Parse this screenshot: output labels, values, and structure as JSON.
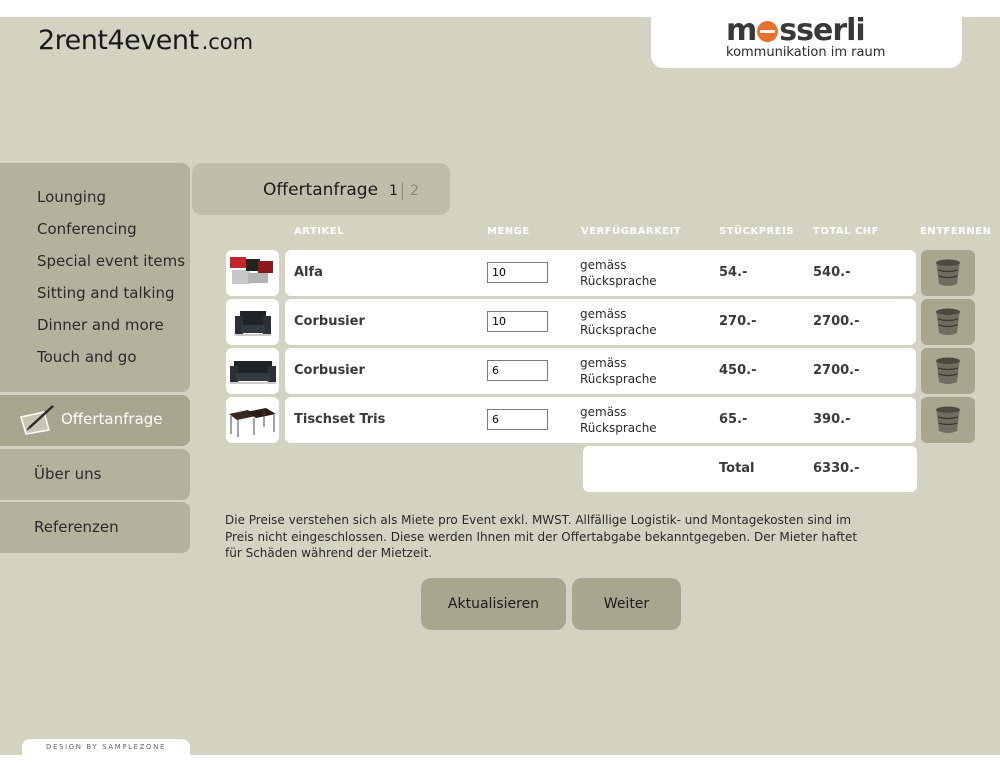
{
  "header": {
    "brand_main": "2rent4event",
    "brand_tld": ".com",
    "logo_prefix": "m",
    "logo_suffix": "sserli",
    "logo_tagline": "kommunikation im raum"
  },
  "nav": {
    "items": [
      "Lounging",
      "Conferencing",
      "Special event items",
      "Sitting and talking",
      "Dinner and more",
      "Touch and go"
    ],
    "offer": "Offertanfrage",
    "about": "Über uns",
    "references": "Referenzen"
  },
  "page": {
    "title": "Offertanfrage",
    "step_current": "1",
    "step_next": "2"
  },
  "table": {
    "headers": {
      "article": "ARTIKEL",
      "quantity": "MENGE",
      "availability": "VERFÜGBARKEIT",
      "unit_price": "STÜCKPREIS",
      "total": "TOTAL CHF",
      "remove": "ENTFERNEN"
    },
    "rows": [
      {
        "article": "Alfa",
        "quantity": "10",
        "availability_1": "gemäss",
        "availability_2": "Rücksprache",
        "unit_price": "54.-",
        "total": "540.-"
      },
      {
        "article": "Corbusier",
        "quantity": "10",
        "availability_1": "gemäss",
        "availability_2": "Rücksprache",
        "unit_price": "270.-",
        "total": "2700.-"
      },
      {
        "article": "Corbusier",
        "quantity": "6",
        "availability_1": "gemäss",
        "availability_2": "Rücksprache",
        "unit_price": "450.-",
        "total": "2700.-"
      },
      {
        "article": "Tischset Tris",
        "quantity": "6",
        "availability_1": "gemäss",
        "availability_2": "Rücksprache",
        "unit_price": "65.-",
        "total": "390.-"
      }
    ],
    "total_label": "Total",
    "total_value": "6330.-"
  },
  "note": "Die Preise verstehen sich als Miete pro Event exkl. MWST. Allfällige Logistik- und Montagekosten sind im Preis nicht eingeschlossen. Diese werden Ihnen mit der Offertabgabe bekanntgegeben. Der Mieter haftet für Schäden während der Mietzeit.",
  "buttons": {
    "update": "Aktualisieren",
    "next": "Weiter"
  },
  "footer": {
    "credit": "DESIGN BY SAMPLEZONE"
  },
  "colors": {
    "background": "#d4d2c0",
    "nav": "#b4b29c",
    "button": "#a8a68e",
    "accent": "#e8722c"
  }
}
